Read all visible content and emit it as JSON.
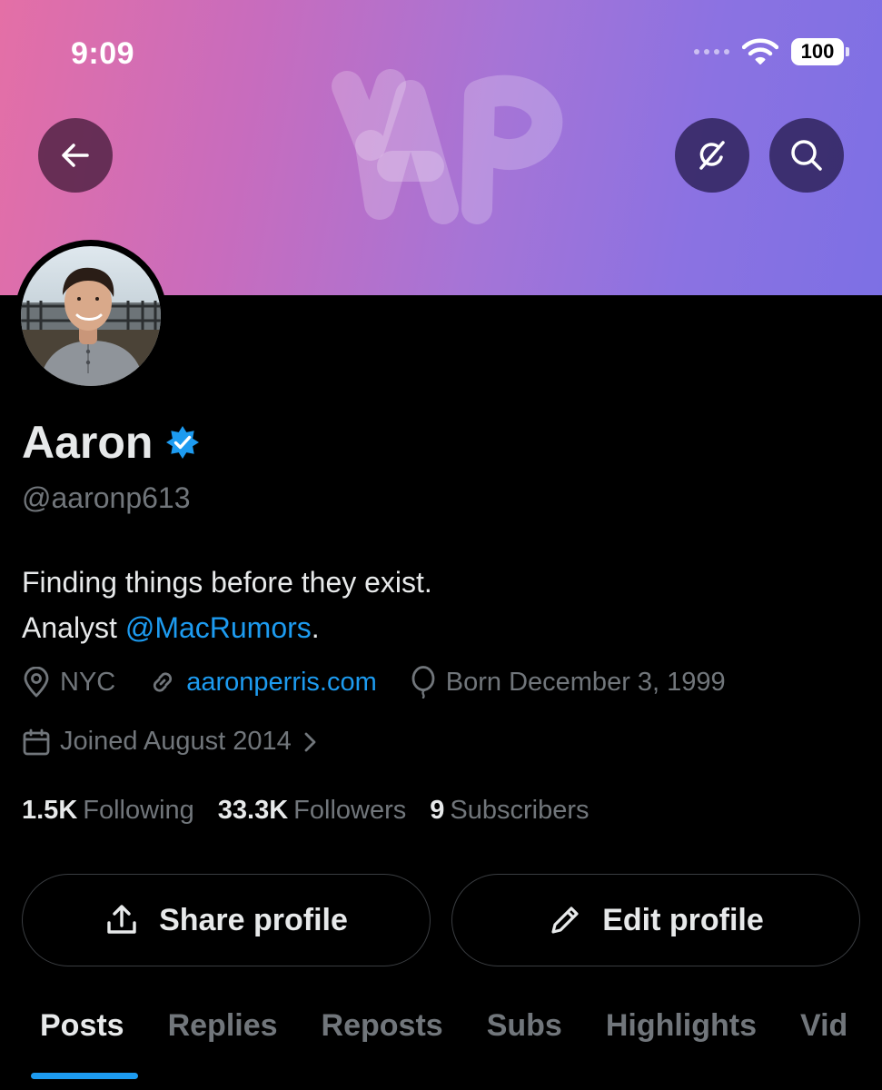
{
  "status_bar": {
    "time": "9:09",
    "battery": "100"
  },
  "profile": {
    "name": "Aaron",
    "handle": "@aaronp613",
    "bio_line1": "Finding things before they exist.",
    "bio_line2_prefix": "Analyst ",
    "bio_mention": "@MacRumors",
    "bio_line2_suffix": ".",
    "location": "NYC",
    "website": "aaronperris.com",
    "birthday": "Born December 3, 1999",
    "joined": "Joined August 2014"
  },
  "stats": [
    {
      "value": "1.5K",
      "label": "Following"
    },
    {
      "value": "33.3K",
      "label": "Followers"
    },
    {
      "value": "9",
      "label": "Subscribers"
    }
  ],
  "actions": {
    "share_label": "Share profile",
    "edit_label": "Edit profile"
  },
  "tabs": [
    "Posts",
    "Replies",
    "Reposts",
    "Subs",
    "Highlights",
    "Vid"
  ],
  "colors": {
    "accent": "#1d9bf0",
    "muted": "#71767b",
    "text": "#e7e9ea",
    "background": "#000000"
  },
  "icons": [
    "arrow-left-icon",
    "grok-icon",
    "search-icon",
    "verified-badge-icon",
    "location-pin-icon",
    "link-icon",
    "balloon-icon",
    "calendar-icon",
    "chevron-right-icon",
    "share-icon",
    "pencil-icon"
  ]
}
